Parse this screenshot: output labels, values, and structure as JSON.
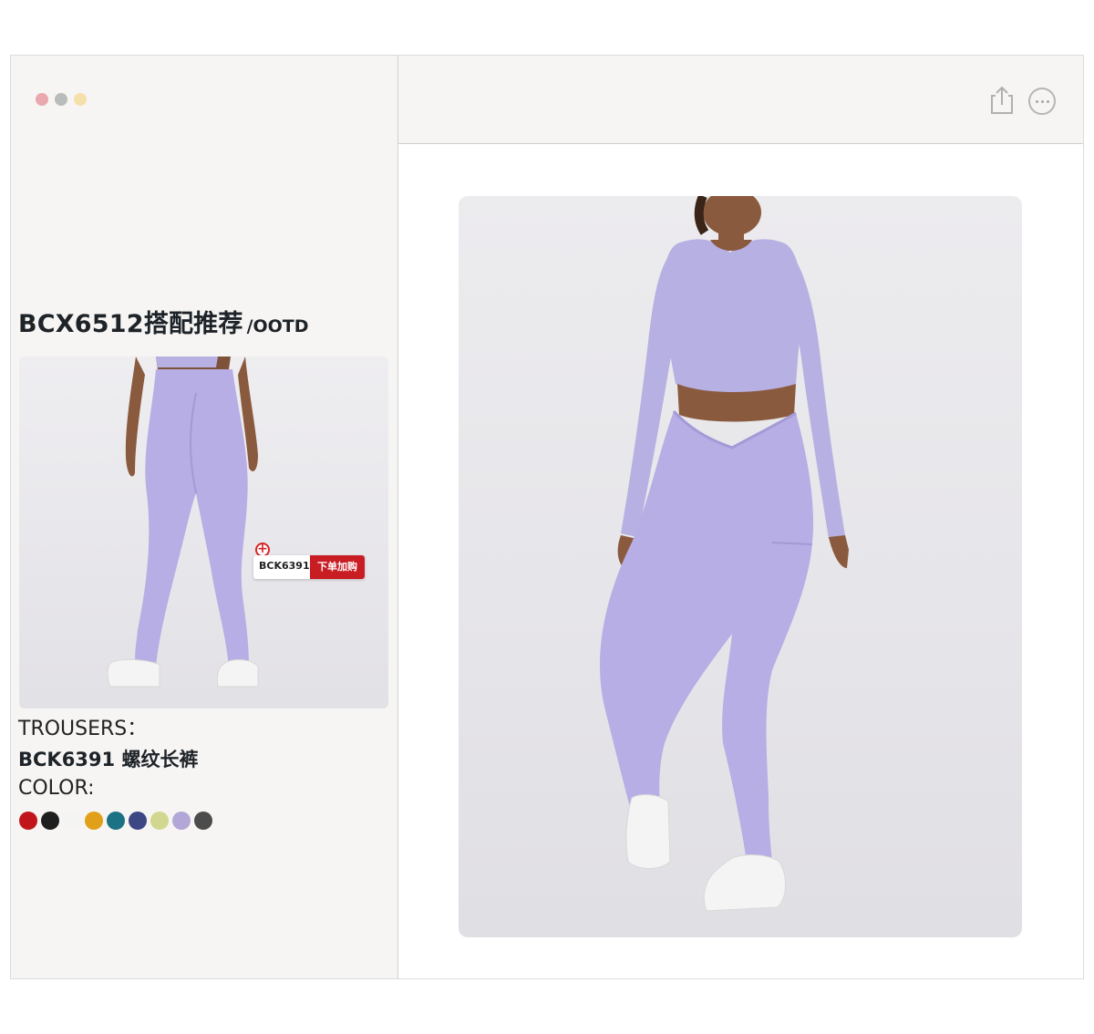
{
  "window": {
    "traffic_light_colors": [
      "#e9a9ae",
      "#b8bcba",
      "#f6e0aa"
    ]
  },
  "toolbar": {
    "share_icon": "share-icon",
    "more_icon": "more-icon"
  },
  "sidebar": {
    "heading_main": "BCX6512搭配推荐",
    "heading_sub": "/OOTD",
    "tag": {
      "code": "BCK6391",
      "action": "下单加购",
      "accent": "#c91d24"
    },
    "trousers_label": "TROUSERS：",
    "product_name": "BCK6391 螺纹长裤",
    "color_label": "COLOR:",
    "swatches": [
      "#c0161b",
      "#1e1e1e",
      "#f4f4f2",
      "#e1a019",
      "#1a7284",
      "#3d4783",
      "#d2d78f",
      "#b2a7d6",
      "#4c4c4c"
    ]
  },
  "product_color": "#b6aee4"
}
